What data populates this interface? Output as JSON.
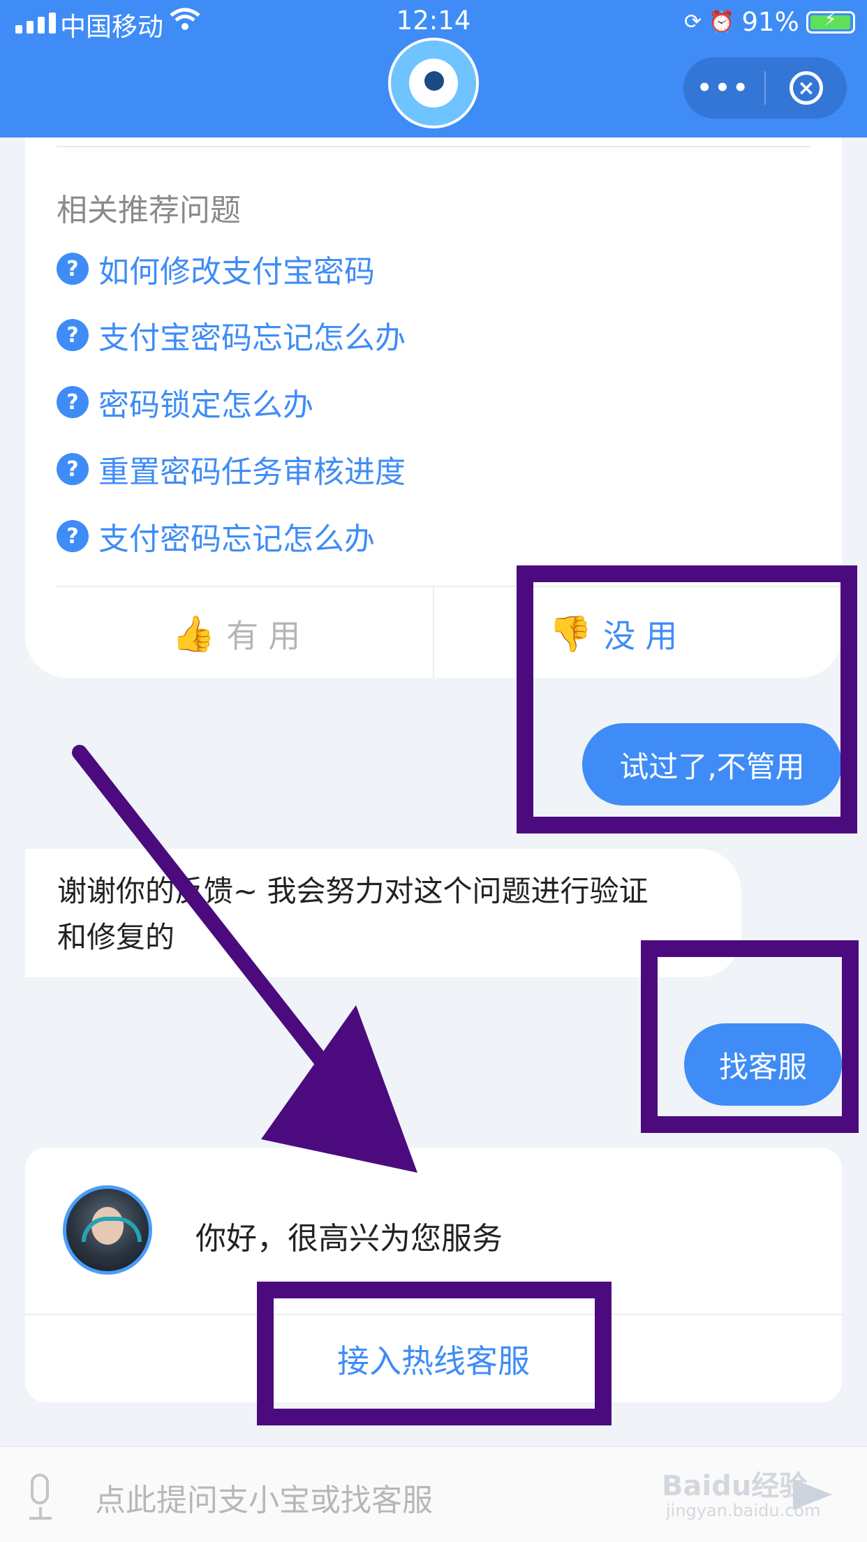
{
  "status_bar": {
    "carrier": "中国移动",
    "time": "12:14",
    "battery": "91%",
    "battery_level": 0.91
  },
  "header": {
    "more_label": "•••",
    "close_label": "×"
  },
  "related": {
    "title": "相关推荐问题",
    "questions": [
      "如何修改支付宝密码",
      "支付宝密码忘记怎么办",
      "密码锁定怎么办",
      "重置密码任务审核进度",
      "支付密码忘记怎么办"
    ]
  },
  "feedback": {
    "useful": "有用",
    "useless": "没用"
  },
  "chat": {
    "user_msg_1": "试过了,不管用",
    "bot_msg_line1": "谢谢你的反馈~ 我会努力对这个问题进行验证",
    "bot_msg_line2": "和修复的",
    "user_msg_2": "找客服"
  },
  "agent": {
    "greeting": "你好，很高兴为您服务",
    "hotline_button": "接入热线客服"
  },
  "input": {
    "placeholder": "点此提问支小宝或找客服"
  },
  "watermark": {
    "brand": "Baidu经验",
    "url": "jingyan.baidu.com"
  },
  "colors": {
    "header": "#3f8cf6",
    "accent": "#3f8cf6",
    "annotation": "#4b0b7e"
  }
}
